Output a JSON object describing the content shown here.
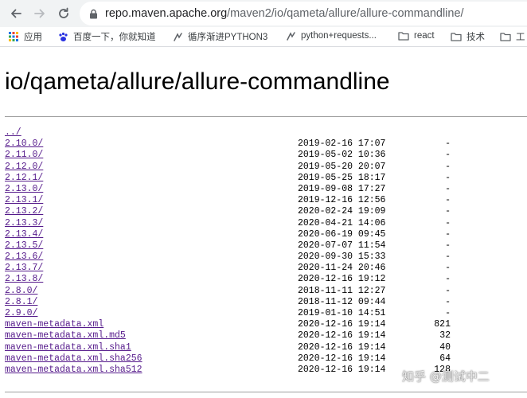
{
  "browser": {
    "url_host": "repo.maven.apache.org",
    "url_path": "/maven2/io/qameta/allure/allure-commandline/",
    "back_icon": "arrow-left-icon",
    "forward_icon": "arrow-right-icon",
    "reload_icon": "reload-icon",
    "lock_icon": "lock-icon"
  },
  "bookmarks": [
    {
      "label": "应用",
      "icon": "apps-grid-icon"
    },
    {
      "label": "百度一下，你就知道",
      "icon": "baidu-paw-icon"
    },
    {
      "label": "循序渐进PYTHON3",
      "icon": "link-icon"
    },
    {
      "label": "python+requests...",
      "icon": "link-icon"
    },
    {
      "label": "react",
      "icon": "folder-icon"
    },
    {
      "label": "技术",
      "icon": "folder-icon"
    },
    {
      "label": "工",
      "icon": "folder-icon"
    }
  ],
  "page": {
    "title": "io/qameta/allure/allure-commandline"
  },
  "listing": [
    {
      "name": "../",
      "date": "",
      "size": ""
    },
    {
      "name": "2.10.0/",
      "date": "2019-02-16 17:07",
      "size": "-"
    },
    {
      "name": "2.11.0/",
      "date": "2019-05-02 10:36",
      "size": "-"
    },
    {
      "name": "2.12.0/",
      "date": "2019-05-20 20:07",
      "size": "-"
    },
    {
      "name": "2.12.1/",
      "date": "2019-05-25 18:17",
      "size": "-"
    },
    {
      "name": "2.13.0/",
      "date": "2019-09-08 17:27",
      "size": "-"
    },
    {
      "name": "2.13.1/",
      "date": "2019-12-16 12:56",
      "size": "-"
    },
    {
      "name": "2.13.2/",
      "date": "2020-02-24 19:09",
      "size": "-"
    },
    {
      "name": "2.13.3/",
      "date": "2020-04-21 14:06",
      "size": "-"
    },
    {
      "name": "2.13.4/",
      "date": "2020-06-19 09:45",
      "size": "-"
    },
    {
      "name": "2.13.5/",
      "date": "2020-07-07 11:54",
      "size": "-"
    },
    {
      "name": "2.13.6/",
      "date": "2020-09-30 15:33",
      "size": "-"
    },
    {
      "name": "2.13.7/",
      "date": "2020-11-24 20:46",
      "size": "-"
    },
    {
      "name": "2.13.8/",
      "date": "2020-12-16 19:12",
      "size": "-"
    },
    {
      "name": "2.8.0/",
      "date": "2018-11-11 12:27",
      "size": "-"
    },
    {
      "name": "2.8.1/",
      "date": "2018-11-12 09:44",
      "size": "-"
    },
    {
      "name": "2.9.0/",
      "date": "2019-01-10 14:51",
      "size": "-"
    },
    {
      "name": "maven-metadata.xml",
      "date": "2020-12-16 19:14",
      "size": "821"
    },
    {
      "name": "maven-metadata.xml.md5",
      "date": "2020-12-16 19:14",
      "size": "32"
    },
    {
      "name": "maven-metadata.xml.sha1",
      "date": "2020-12-16 19:14",
      "size": "40"
    },
    {
      "name": "maven-metadata.xml.sha256",
      "date": "2020-12-16 19:14",
      "size": "64"
    },
    {
      "name": "maven-metadata.xml.sha512",
      "date": "2020-12-16 19:14",
      "size": "128"
    }
  ],
  "watermark": {
    "text": "知乎 @测试中二"
  },
  "colors": {
    "link": "#551a8b",
    "toolbar": "#f1f3f4",
    "rule": "#9e9e9e"
  }
}
